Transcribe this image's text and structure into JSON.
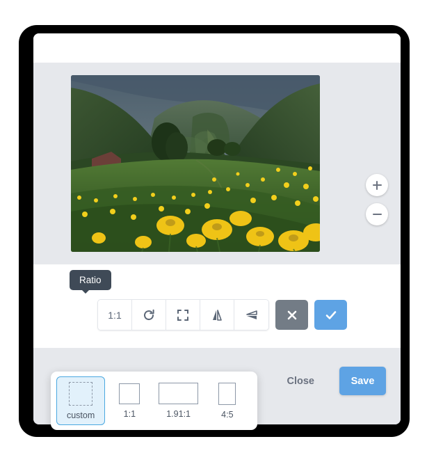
{
  "modal": {
    "image_alt": "mountain-meadow-dandelions-photo"
  },
  "stage": {
    "zoom_in_icon": "plus-icon",
    "zoom_out_icon": "minus-icon"
  },
  "toolbar": {
    "tooltip": "Ratio",
    "tools": [
      {
        "name": "ratio-button",
        "label": "1:1",
        "icon": ""
      },
      {
        "name": "rotate-button",
        "label": "",
        "icon": "rotate-icon"
      },
      {
        "name": "fit-crop-button",
        "label": "",
        "icon": "crop-corners-icon"
      },
      {
        "name": "flip-horizontal-button",
        "label": "",
        "icon": "flip-horizontal-icon"
      },
      {
        "name": "flip-vertical-button",
        "label": "",
        "icon": "flip-vertical-icon"
      }
    ],
    "cancel_icon": "close-x-icon",
    "confirm_icon": "check-icon"
  },
  "footer": {
    "close_label": "Close",
    "save_label": "Save"
  },
  "ratio_panel": {
    "options": [
      {
        "label": "custom",
        "selected": true,
        "shape": "dashed-square"
      },
      {
        "label": "1:1",
        "selected": false,
        "shape": "square"
      },
      {
        "label": "1.91:1",
        "selected": false,
        "shape": "wide-rectangle"
      },
      {
        "label": "4:5",
        "selected": false,
        "shape": "tall-rectangle"
      }
    ]
  },
  "colors": {
    "accent_blue": "#5ea3e4",
    "tooltip_dark": "#3f4a57",
    "cancel_gray": "#737c86",
    "stage_gray": "#e6e8ec",
    "selected_tile": "#e2f1fb",
    "selected_border": "#4aa8e0"
  }
}
